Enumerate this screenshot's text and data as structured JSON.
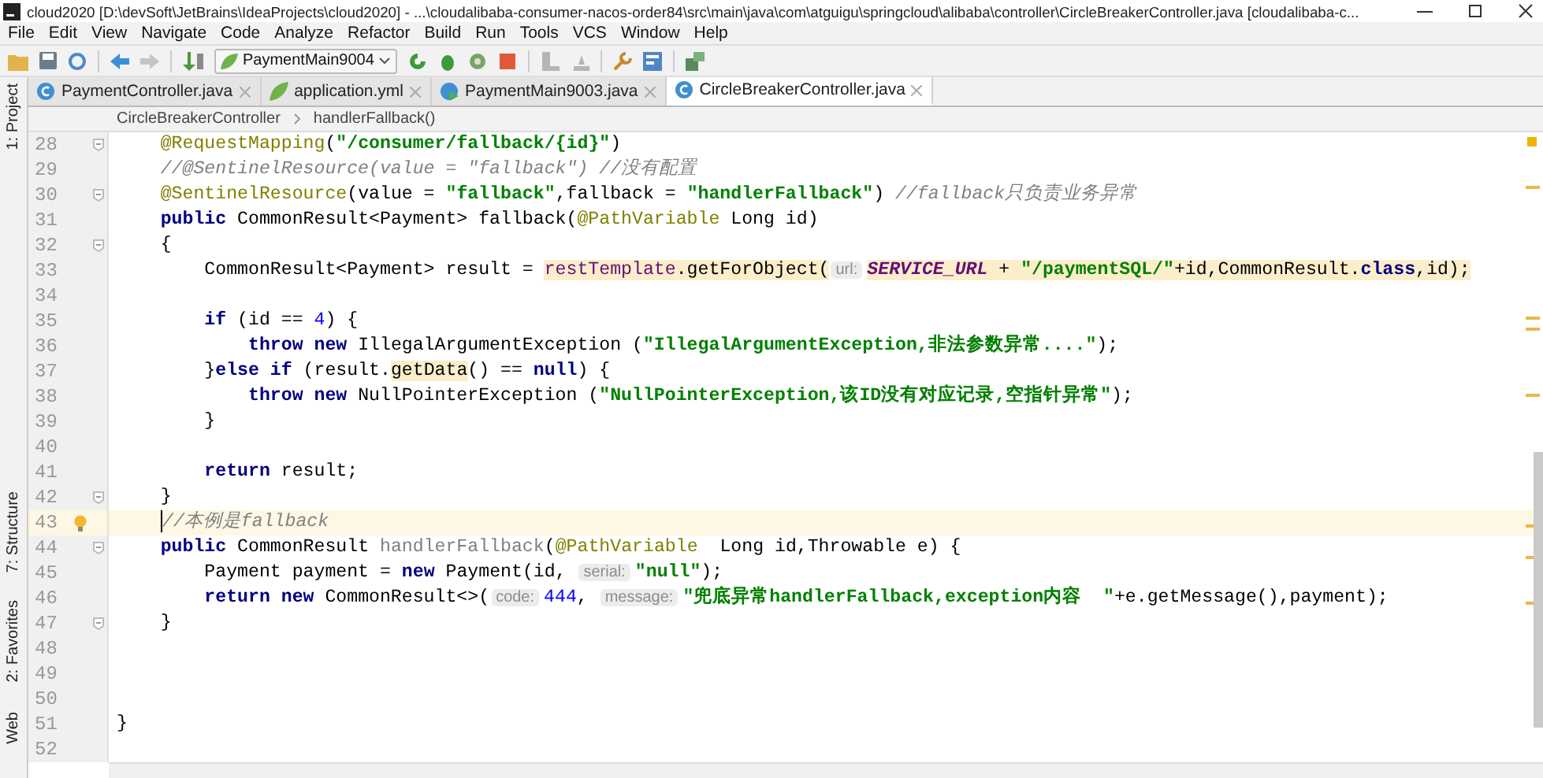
{
  "window": {
    "title": "cloud2020 [D:\\devSoft\\JetBrains\\IdeaProjects\\cloud2020] - ...\\cloudalibaba-consumer-nacos-order84\\src\\main\\java\\com\\atguigu\\springcloud\\alibaba\\controller\\CircleBreakerController.java [cloudalibaba-c..."
  },
  "menu": [
    "File",
    "Edit",
    "View",
    "Navigate",
    "Code",
    "Analyze",
    "Refactor",
    "Build",
    "Run",
    "Tools",
    "VCS",
    "Window",
    "Help"
  ],
  "toolbar": {
    "run_config": "PaymentMain9004"
  },
  "tool_windows": {
    "top": [
      {
        "label": "1: Project"
      }
    ],
    "bottom": [
      {
        "label": "7: Structure"
      },
      {
        "label": "2: Favorites"
      },
      {
        "label": "Web"
      }
    ]
  },
  "tabs": [
    {
      "label": "PaymentController.java",
      "kind": "class",
      "selected": false
    },
    {
      "label": "application.yml",
      "kind": "yaml",
      "selected": false
    },
    {
      "label": "PaymentMain9003.java",
      "kind": "main",
      "selected": false
    },
    {
      "label": "CircleBreakerController.java",
      "kind": "class",
      "selected": true
    }
  ],
  "breadcrumb": [
    "CircleBreakerController",
    "handlerFallback()"
  ],
  "editor": {
    "lines": [
      {
        "number": "28",
        "fold": true,
        "tokens": [
          {
            "text": "    @RequestMapping",
            "kind": "ann"
          },
          {
            "text": "("
          },
          {
            "text": "\"/consumer/fallback/{id}\"",
            "kind": "str"
          },
          {
            "text": ")"
          }
        ]
      },
      {
        "number": "29",
        "tokens": [
          {
            "text": "    //@SentinelResource(value = \"fallback\") //没有配置",
            "kind": "cmt"
          }
        ]
      },
      {
        "number": "30",
        "fold": true,
        "tokens": [
          {
            "text": "    @SentinelResource",
            "kind": "ann"
          },
          {
            "text": "(value = "
          },
          {
            "text": "\"fallback\"",
            "kind": "str"
          },
          {
            "text": ",fallback = "
          },
          {
            "text": "\"handlerFallback\"",
            "kind": "str"
          },
          {
            "text": ") "
          },
          {
            "text": "//fallback只负责业务异常",
            "kind": "cmt"
          }
        ]
      },
      {
        "number": "31",
        "tokens": [
          {
            "text": "    public",
            "kind": "kw"
          },
          {
            "text": " CommonResult<Payment> fallback("
          },
          {
            "text": "@PathVariable",
            "kind": "ann"
          },
          {
            "text": " Long id)"
          }
        ]
      },
      {
        "number": "32",
        "fold": true,
        "tokens": [
          {
            "text": "    {"
          }
        ]
      },
      {
        "number": "33",
        "tokens": [
          {
            "text": "        CommonResult<Payment> result = "
          },
          {
            "text": "restTemplate",
            "kind": "fld",
            "marked": true
          },
          {
            "text": ".getForObject(",
            "marked": true
          },
          {
            "text": "url:",
            "kind": "hint",
            "marked": true
          },
          {
            "text": "SERVICE_URL",
            "kind": "const",
            "marked": true
          },
          {
            "text": " + ",
            "marked": true
          },
          {
            "text": "\"/paymentSQL/\"",
            "kind": "str",
            "marked": true
          },
          {
            "text": "+id,CommonResult.",
            "marked": true
          },
          {
            "text": "class",
            "kind": "kw",
            "marked": true
          },
          {
            "text": ",id);",
            "marked": true
          }
        ]
      },
      {
        "number": "34"
      },
      {
        "number": "35",
        "tokens": [
          {
            "text": "        if",
            "kind": "kw"
          },
          {
            "text": " (id == "
          },
          {
            "text": "4",
            "kind": "num"
          },
          {
            "text": ") {"
          }
        ]
      },
      {
        "number": "36",
        "tokens": [
          {
            "text": "            throw new",
            "kind": "kw"
          },
          {
            "text": " IllegalArgumentException ("
          },
          {
            "text": "\"IllegalArgumentException,非法参数异常....\"",
            "kind": "str"
          },
          {
            "text": ");"
          }
        ]
      },
      {
        "number": "37",
        "tokens": [
          {
            "text": "        }"
          },
          {
            "text": "else if",
            "kind": "kw"
          },
          {
            "text": " (result."
          },
          {
            "text": "getData",
            "marked": true
          },
          {
            "text": "() == "
          },
          {
            "text": "null",
            "kind": "kw"
          },
          {
            "text": ") {"
          }
        ]
      },
      {
        "number": "38",
        "tokens": [
          {
            "text": "            throw new",
            "kind": "kw"
          },
          {
            "text": " NullPointerException ("
          },
          {
            "text": "\"NullPointerException,该ID没有对应记录,空指针异常\"",
            "kind": "str"
          },
          {
            "text": ");"
          }
        ]
      },
      {
        "number": "39",
        "tokens": [
          {
            "text": "        }"
          }
        ]
      },
      {
        "number": "40"
      },
      {
        "number": "41",
        "tokens": [
          {
            "text": "        return",
            "kind": "kw"
          },
          {
            "text": " result;"
          }
        ]
      },
      {
        "number": "42",
        "fold": true,
        "tokens": [
          {
            "text": "    }"
          }
        ]
      },
      {
        "number": "43",
        "current": true,
        "bulb": true,
        "tokens": [
          {
            "text": "//本例是fallback",
            "kind": "cmt"
          }
        ]
      },
      {
        "number": "44",
        "fold": true,
        "tokens": [
          {
            "text": "    public",
            "kind": "kw"
          },
          {
            "text": " CommonResult "
          },
          {
            "text": "handlerFallback",
            "kind": "unused"
          },
          {
            "text": "("
          },
          {
            "text": "@PathVariable",
            "kind": "ann"
          },
          {
            "text": "  Long id,Throwable e) {"
          }
        ]
      },
      {
        "number": "45",
        "tokens": [
          {
            "text": "        Payment payment = "
          },
          {
            "text": "new",
            "kind": "kw"
          },
          {
            "text": " Payment(id, "
          },
          {
            "text": "serial:",
            "kind": "hint"
          },
          {
            "text": "\"null\"",
            "kind": "str"
          },
          {
            "text": ");"
          }
        ]
      },
      {
        "number": "46",
        "tokens": [
          {
            "text": "        return new",
            "kind": "kw"
          },
          {
            "text": " CommonResult<>("
          },
          {
            "text": "code:",
            "kind": "hint"
          },
          {
            "text": "444",
            "kind": "num"
          },
          {
            "text": ", "
          },
          {
            "text": "message:",
            "kind": "hint"
          },
          {
            "text": "\"兜底异常handlerFallback,exception内容  \"",
            "kind": "str"
          },
          {
            "text": "+e.getMessage(),payment);"
          }
        ]
      },
      {
        "number": "47",
        "fold": true,
        "tokens": [
          {
            "text": "    }"
          }
        ]
      },
      {
        "number": "48"
      },
      {
        "number": "49"
      },
      {
        "number": "50"
      },
      {
        "number": "51",
        "tokens": [
          {
            "text": "}"
          }
        ]
      },
      {
        "number": "52"
      }
    ]
  }
}
